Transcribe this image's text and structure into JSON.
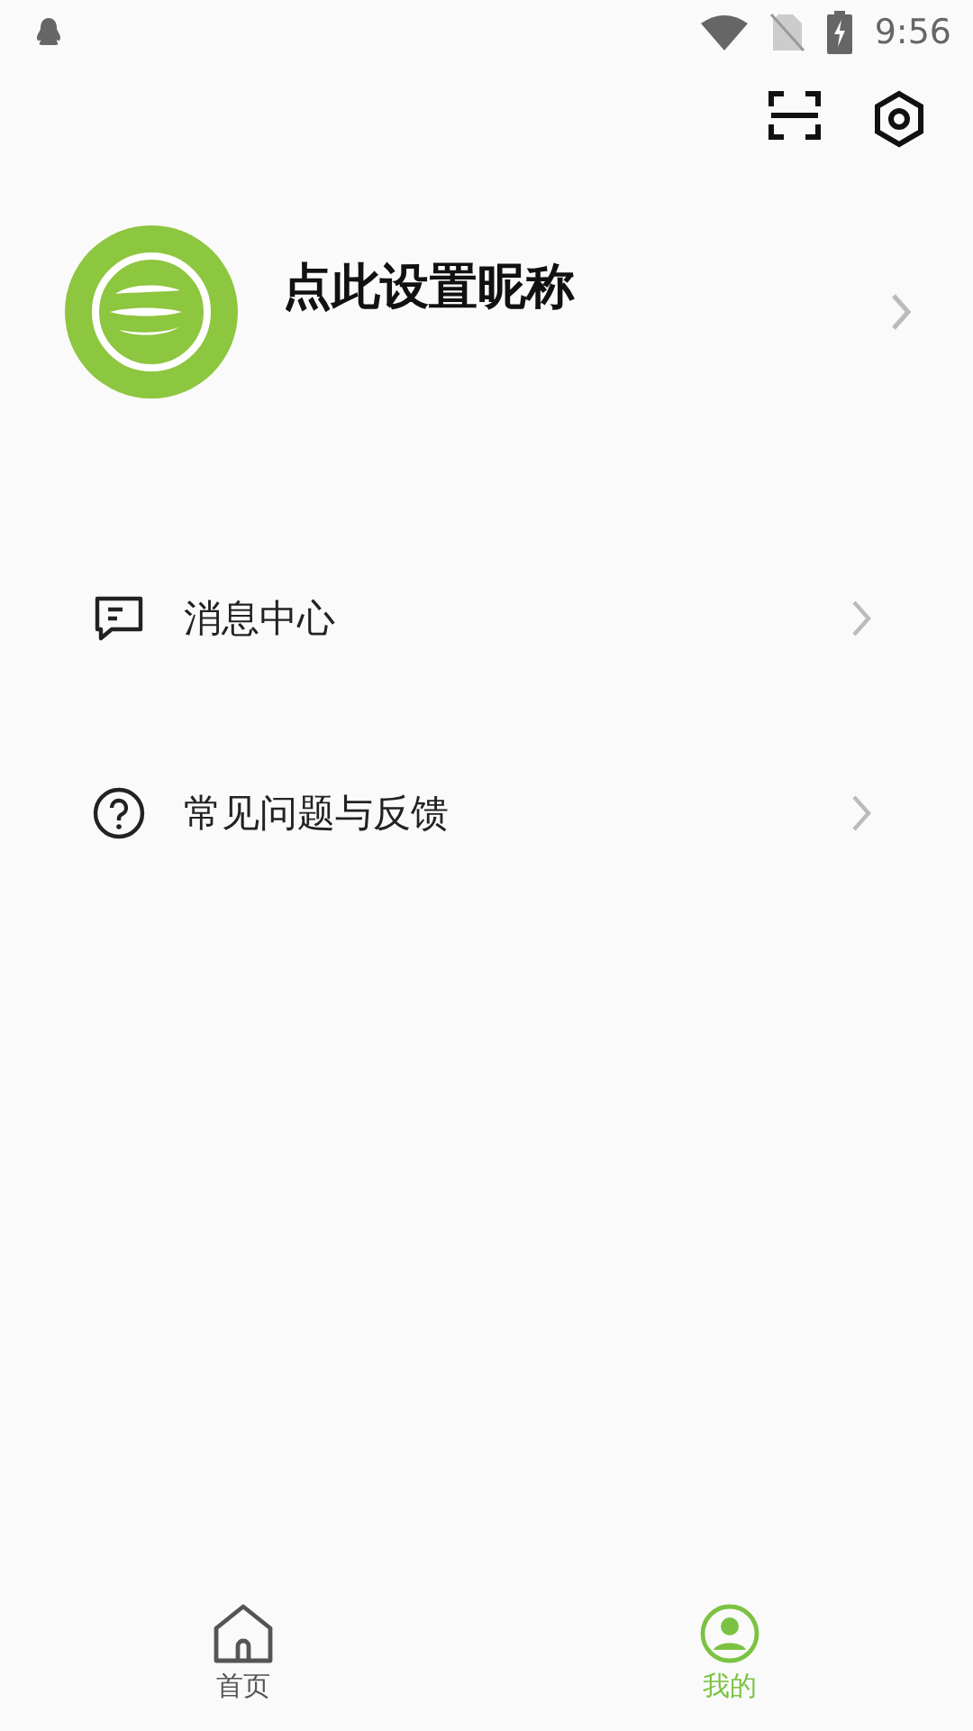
{
  "status_bar": {
    "time": "9:56"
  },
  "profile": {
    "nickname": "点此设置昵称"
  },
  "menu": [
    {
      "kind": "message",
      "label": "消息中心"
    },
    {
      "kind": "help",
      "label": "常见问题与反馈"
    }
  ],
  "tabs": [
    {
      "kind": "home",
      "label": "首页",
      "selected": false
    },
    {
      "kind": "mine",
      "label": "我的",
      "selected": true
    }
  ]
}
